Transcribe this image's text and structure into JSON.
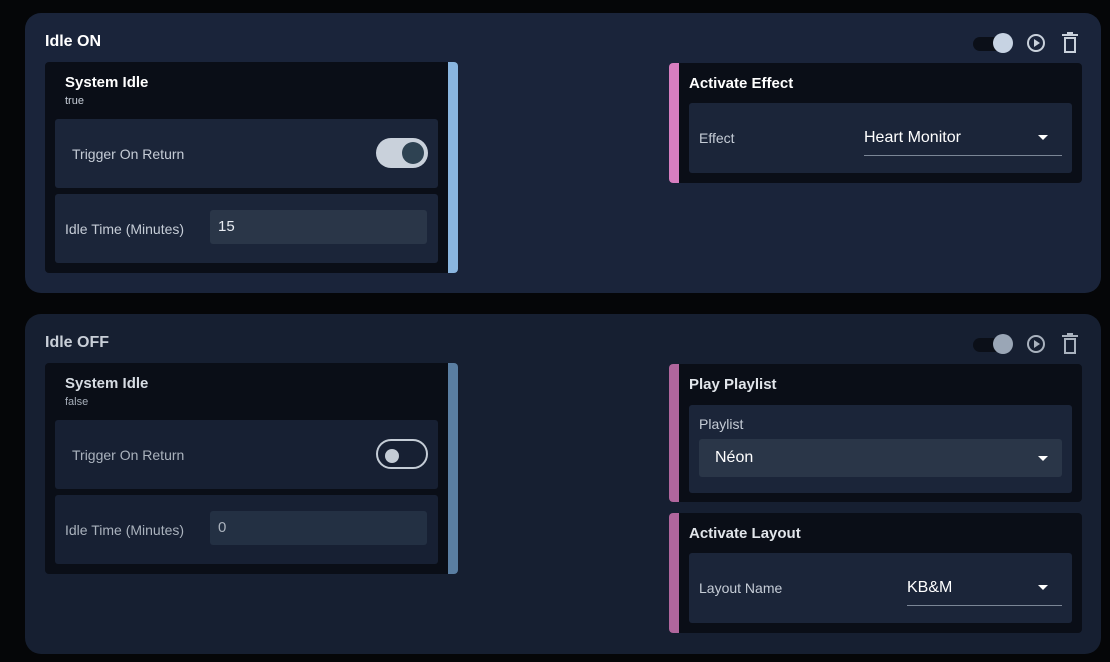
{
  "rules": [
    {
      "title": "Idle ON",
      "enabled": true,
      "trigger": {
        "title": "System Idle",
        "value": "true",
        "trigger_on_return_label": "Trigger On Return",
        "trigger_on_return": true,
        "idle_time_label": "Idle Time (Minutes)",
        "idle_time_value": "15"
      },
      "actions": [
        {
          "title": "Activate Effect",
          "field_label": "Effect",
          "field_value": "Heart Monitor"
        }
      ]
    },
    {
      "title": "Idle OFF",
      "enabled": true,
      "trigger": {
        "title": "System Idle",
        "value": "false",
        "trigger_on_return_label": "Trigger On Return",
        "trigger_on_return": false,
        "idle_time_label": "Idle Time (Minutes)",
        "idle_time_value": "0"
      },
      "actions": [
        {
          "title": "Play Playlist",
          "field_label": "Playlist",
          "field_value": "Néon"
        },
        {
          "title": "Activate Layout",
          "field_label": "Layout Name",
          "field_value": "KB&M"
        }
      ]
    }
  ],
  "icons": {
    "toggle": "toggle-icon",
    "play": "play-circle-icon",
    "delete": "trash-icon"
  },
  "colors": {
    "trigger_bar": "#8ab6e0",
    "trigger_bar_muted": "#5a7ea2",
    "action_bar": "#d77ec0",
    "action_bar_muted": "#b0669d"
  }
}
